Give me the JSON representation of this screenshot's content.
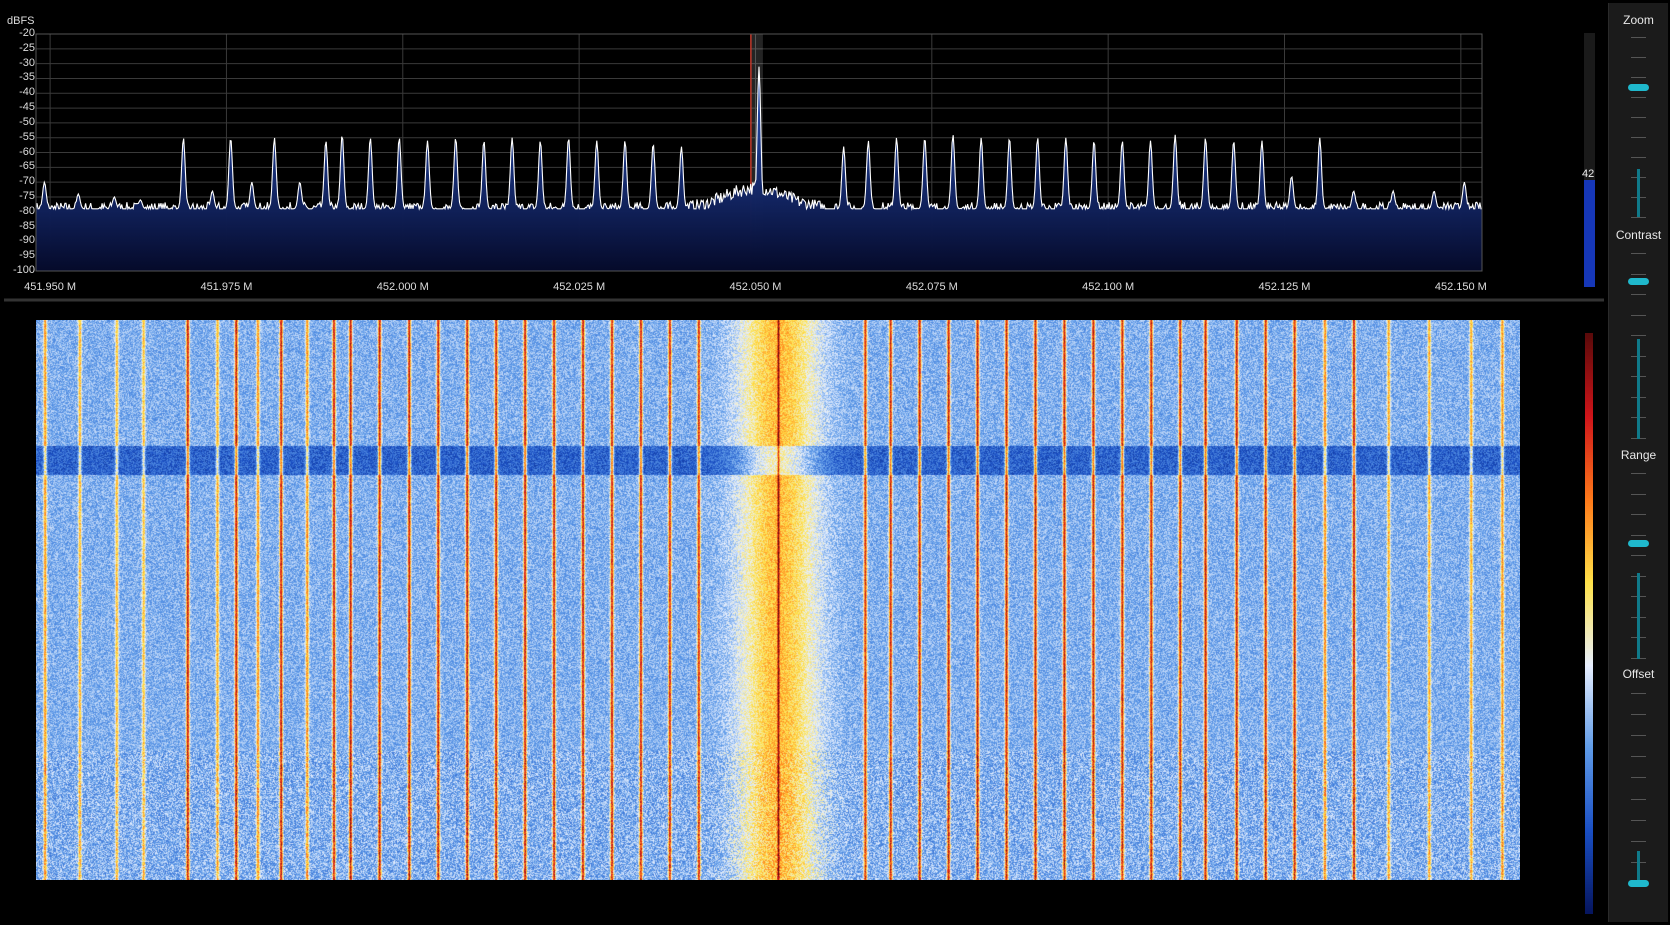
{
  "spectrum": {
    "unit_label": "dBFS",
    "db_ticks": [
      "-20",
      "-25",
      "-30",
      "-35",
      "-40",
      "-45",
      "-50",
      "-55",
      "-60",
      "-65",
      "-70",
      "-75",
      "-80",
      "-85",
      "-90",
      "-95",
      "-100"
    ],
    "freq_ticks": [
      "451.950 M",
      "451.975 M",
      "452.000 M",
      "452.025 M",
      "452.050 M",
      "452.075 M",
      "452.100 M",
      "452.125 M",
      "452.150 M"
    ],
    "db_range": [
      -100,
      -20
    ],
    "freq_range_mhz": [
      451.948,
      452.153
    ],
    "tuned_frequency_mhz": 452.0502,
    "noise_floor_db": -79,
    "level_value": "42",
    "level_fraction": 0.42,
    "trace_color": "#ffffff",
    "fill_color": "#1e3a8a",
    "marker_color": "#c0392b",
    "peaks": [
      {
        "f": 451.9492,
        "db": -70
      },
      {
        "f": 451.954,
        "db": -74
      },
      {
        "f": 451.9591,
        "db": -75
      },
      {
        "f": 451.9628,
        "db": -76
      },
      {
        "f": 451.9689,
        "db": -55
      },
      {
        "f": 451.973,
        "db": -73
      },
      {
        "f": 451.9756,
        "db": -55
      },
      {
        "f": 451.9786,
        "db": -70
      },
      {
        "f": 451.9818,
        "db": -55
      },
      {
        "f": 451.9854,
        "db": -70
      },
      {
        "f": 451.9891,
        "db": -56
      },
      {
        "f": 451.9914,
        "db": -54
      },
      {
        "f": 451.9954,
        "db": -55
      },
      {
        "f": 451.9995,
        "db": -55
      },
      {
        "f": 452.0035,
        "db": -56
      },
      {
        "f": 452.0075,
        "db": -55
      },
      {
        "f": 452.0115,
        "db": -56
      },
      {
        "f": 452.0155,
        "db": -55
      },
      {
        "f": 452.0195,
        "db": -56
      },
      {
        "f": 452.0235,
        "db": -55
      },
      {
        "f": 452.0275,
        "db": -56
      },
      {
        "f": 452.0315,
        "db": -56
      },
      {
        "f": 452.0355,
        "db": -57
      },
      {
        "f": 452.0395,
        "db": -58
      },
      {
        "f": 452.0505,
        "db": -31
      },
      {
        "f": 452.0625,
        "db": -58
      },
      {
        "f": 452.066,
        "db": -56
      },
      {
        "f": 452.07,
        "db": -55
      },
      {
        "f": 452.074,
        "db": -55
      },
      {
        "f": 452.078,
        "db": -54
      },
      {
        "f": 452.082,
        "db": -55
      },
      {
        "f": 452.086,
        "db": -55
      },
      {
        "f": 452.09,
        "db": -55
      },
      {
        "f": 452.094,
        "db": -55
      },
      {
        "f": 452.098,
        "db": -56
      },
      {
        "f": 452.102,
        "db": -56
      },
      {
        "f": 452.106,
        "db": -56
      },
      {
        "f": 452.1095,
        "db": -54
      },
      {
        "f": 452.1138,
        "db": -55
      },
      {
        "f": 452.1178,
        "db": -56
      },
      {
        "f": 452.1218,
        "db": -56
      },
      {
        "f": 452.126,
        "db": -68
      },
      {
        "f": 452.13,
        "db": -55
      },
      {
        "f": 452.1348,
        "db": -73
      },
      {
        "f": 452.1404,
        "db": -73
      },
      {
        "f": 452.1462,
        "db": -73
      },
      {
        "f": 452.1505,
        "db": -70
      }
    ]
  },
  "waterfall": {
    "colormap": [
      "#06155e",
      "#1a4fc4",
      "#5f9be8",
      "#e8f0ff",
      "#ffe24a",
      "#ff7a1a",
      "#d0151a",
      "#5a0a0a"
    ],
    "colorbar_label": ""
  },
  "sidebar": {
    "zoom_label": "Zoom",
    "contrast_label": "Contrast",
    "range_label": "Range",
    "offset_label": "Offset",
    "zoom_value": 0.72,
    "contrast_value": 0.85,
    "range_value": 0.62,
    "offset_value": 0.0
  }
}
